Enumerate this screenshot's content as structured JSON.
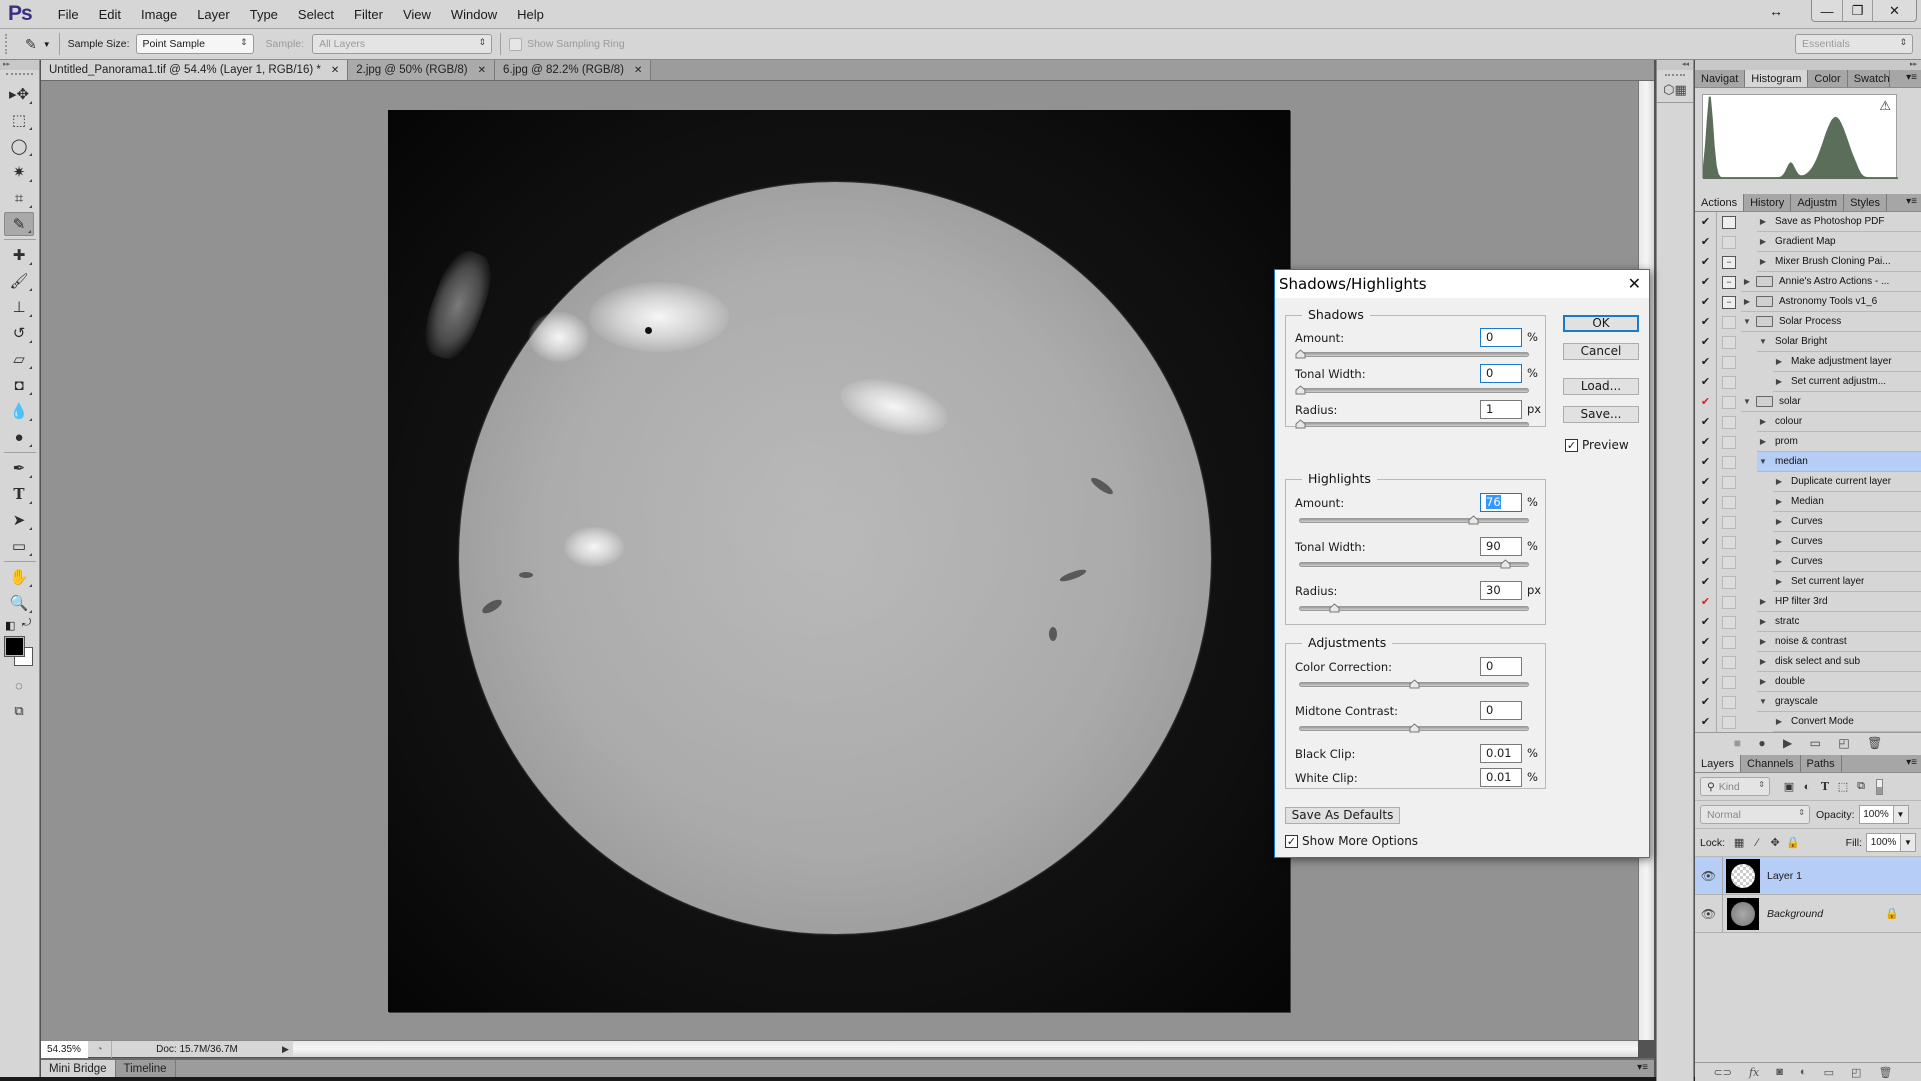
{
  "app": {
    "logo": "Ps",
    "menu": [
      "File",
      "Edit",
      "Image",
      "Layer",
      "Type",
      "Select",
      "Filter",
      "View",
      "Window",
      "Help"
    ],
    "window_controls": {
      "minimize": "—",
      "restore": "❐",
      "close": "✕",
      "resize": "↔"
    }
  },
  "options_bar": {
    "tool_icon": "eyedropper-icon",
    "sample_size_label": "Sample Size:",
    "sample_size_value": "Point Sample",
    "sample_label": "Sample:",
    "sample_value": "All Layers",
    "show_sampling_ring_label": "Show Sampling Ring",
    "show_sampling_ring_checked": false,
    "workspace": "Essentials"
  },
  "document_tabs": [
    {
      "label": "Untitled_Panorama1.tif @ 54.4% (Layer 1, RGB/16) *",
      "active": true
    },
    {
      "label": "2.jpg @ 50% (RGB/8)",
      "active": false
    },
    {
      "label": "6.jpg @ 82.2% (RGB/8)",
      "active": false
    }
  ],
  "tools": [
    {
      "name": "move-tool",
      "glyph": "▸✥"
    },
    {
      "name": "rectangular-marquee-tool",
      "glyph": "⬚"
    },
    {
      "name": "lasso-tool",
      "glyph": "◯"
    },
    {
      "name": "quick-selection-tool",
      "glyph": "✷"
    },
    {
      "name": "crop-tool",
      "glyph": "⌗"
    },
    {
      "name": "eyedropper-tool",
      "glyph": "✎",
      "active": true
    },
    {
      "sep": true
    },
    {
      "name": "spot-healing-brush-tool",
      "glyph": "✚"
    },
    {
      "name": "brush-tool",
      "glyph": "🖌"
    },
    {
      "name": "clone-stamp-tool",
      "glyph": "⊥"
    },
    {
      "name": "history-brush-tool",
      "glyph": "↺"
    },
    {
      "name": "eraser-tool",
      "glyph": "▱"
    },
    {
      "name": "paint-bucket-tool",
      "glyph": "◘"
    },
    {
      "name": "blur-tool",
      "glyph": "💧"
    },
    {
      "name": "dodge-tool",
      "glyph": "●"
    },
    {
      "sep": true
    },
    {
      "name": "pen-tool",
      "glyph": "✒"
    },
    {
      "name": "type-tool",
      "glyph": "T"
    },
    {
      "name": "path-selection-tool",
      "glyph": "➤"
    },
    {
      "name": "rectangle-tool",
      "glyph": "▭"
    },
    {
      "sep": true
    },
    {
      "name": "hand-tool",
      "glyph": "✋"
    },
    {
      "name": "zoom-tool",
      "glyph": "🔍"
    }
  ],
  "colors": {
    "foreground": "#000000",
    "background": "#ffffff",
    "accent": "#1979ca",
    "selection": "#b6cdf5",
    "histogram_fill": "#5b6e5a"
  },
  "status_bar": {
    "zoom": "54.35%",
    "doc_info": "Doc: 15.7M/36.7M"
  },
  "bottom_tabs": [
    {
      "label": "Mini Bridge",
      "active": true
    },
    {
      "label": "Timeline",
      "active": false
    }
  ],
  "histogram_panel": {
    "tabs": [
      {
        "label": "Navigat",
        "active": false
      },
      {
        "label": "Histogram",
        "active": true
      },
      {
        "label": "Color",
        "active": false
      },
      {
        "label": "Swatch",
        "active": false
      }
    ],
    "warning_icon": "⚠"
  },
  "actions_panel": {
    "tabs": [
      {
        "label": "Actions",
        "active": true
      },
      {
        "label": "History",
        "active": false
      },
      {
        "label": "Adjustm",
        "active": false
      },
      {
        "label": "Styles",
        "active": false
      }
    ],
    "rows": [
      {
        "label": "Save as Photoshop PDF",
        "level": 1,
        "expanded": false,
        "folder": false,
        "dialog": "on",
        "check": "black"
      },
      {
        "label": "Gradient Map",
        "level": 1,
        "expanded": false,
        "folder": false,
        "dialog": "off",
        "check": "black"
      },
      {
        "label": "Mixer Brush Cloning Pai...",
        "level": 1,
        "expanded": false,
        "folder": false,
        "dialog": "partial",
        "check": "black"
      },
      {
        "label": "Annie's Astro Actions - ...",
        "level": 0,
        "expanded": false,
        "folder": true,
        "dialog": "partial",
        "check": "black"
      },
      {
        "label": "Astronomy Tools v1_6",
        "level": 0,
        "expanded": false,
        "folder": true,
        "dialog": "partial",
        "check": "black"
      },
      {
        "label": "Solar Process",
        "level": 0,
        "expanded": true,
        "folder": true,
        "dialog": "off",
        "check": "black"
      },
      {
        "label": "Solar Bright",
        "level": 1,
        "expanded": true,
        "folder": false,
        "dialog": "off",
        "check": "black"
      },
      {
        "label": "Make adjustment layer",
        "level": 2,
        "expanded": false,
        "folder": false,
        "dialog": "off",
        "check": "black"
      },
      {
        "label": "Set current adjustm...",
        "level": 2,
        "expanded": false,
        "folder": false,
        "dialog": "off",
        "check": "black"
      },
      {
        "label": "solar",
        "level": 0,
        "expanded": true,
        "folder": true,
        "dialog": "off",
        "check": "red"
      },
      {
        "label": "colour",
        "level": 1,
        "expanded": false,
        "folder": false,
        "dialog": "off",
        "check": "black"
      },
      {
        "label": "prom",
        "level": 1,
        "expanded": false,
        "folder": false,
        "dialog": "off",
        "check": "black"
      },
      {
        "label": "median",
        "level": 1,
        "expanded": true,
        "folder": false,
        "dialog": "off",
        "check": "black",
        "selected": true
      },
      {
        "label": "Duplicate current layer",
        "level": 2,
        "expanded": false,
        "folder": false,
        "dialog": "off",
        "check": "black"
      },
      {
        "label": "Median",
        "level": 2,
        "expanded": false,
        "folder": false,
        "dialog": "off",
        "check": "black"
      },
      {
        "label": "Curves",
        "level": 2,
        "expanded": false,
        "folder": false,
        "dialog": "off",
        "check": "black"
      },
      {
        "label": "Curves",
        "level": 2,
        "expanded": false,
        "folder": false,
        "dialog": "off",
        "check": "black"
      },
      {
        "label": "Curves",
        "level": 2,
        "expanded": false,
        "folder": false,
        "dialog": "off",
        "check": "black"
      },
      {
        "label": "Set current layer",
        "level": 2,
        "expanded": false,
        "folder": false,
        "dialog": "off",
        "check": "black"
      },
      {
        "label": "HP filter 3rd",
        "level": 1,
        "expanded": false,
        "folder": false,
        "dialog": "off",
        "check": "red"
      },
      {
        "label": "stratc",
        "level": 1,
        "expanded": false,
        "folder": false,
        "dialog": "off",
        "check": "black"
      },
      {
        "label": "noise & contrast",
        "level": 1,
        "expanded": false,
        "folder": false,
        "dialog": "off",
        "check": "black"
      },
      {
        "label": "disk select and sub",
        "level": 1,
        "expanded": false,
        "folder": false,
        "dialog": "off",
        "check": "black"
      },
      {
        "label": "double",
        "level": 1,
        "expanded": false,
        "folder": false,
        "dialog": "off",
        "check": "black"
      },
      {
        "label": "grayscale",
        "level": 1,
        "expanded": true,
        "folder": false,
        "dialog": "off",
        "check": "black"
      },
      {
        "label": "Convert Mode",
        "level": 2,
        "expanded": false,
        "folder": false,
        "dialog": "off",
        "check": "black"
      }
    ],
    "buttons": [
      "stop-icon",
      "record-icon",
      "play-icon",
      "new-set-icon",
      "new-action-icon",
      "trash-icon"
    ]
  },
  "layers_panel": {
    "tabs": [
      {
        "label": "Layers",
        "active": true
      },
      {
        "label": "Channels",
        "active": false
      },
      {
        "label": "Paths",
        "active": false
      }
    ],
    "filter_kind": "Kind",
    "blend_mode": "Normal",
    "opacity_label": "Opacity:",
    "opacity": "100%",
    "lock_label": "Lock:",
    "fill_label": "Fill:",
    "fill": "100%",
    "layers": [
      {
        "name": "Layer 1",
        "visible": true,
        "selected": true,
        "locked": false
      },
      {
        "name": "Background",
        "visible": true,
        "selected": false,
        "locked": true
      }
    ]
  },
  "dialog": {
    "title": "Shadows/Highlights",
    "shadows": {
      "legend": "Shadows",
      "amount_label": "Amount:",
      "amount": "0",
      "amount_unit": "%",
      "tonal_width_label": "Tonal Width:",
      "tonal_width": "0",
      "tonal_width_unit": "%",
      "radius_label": "Radius:",
      "radius": "1",
      "radius_unit": "px",
      "amount_slider": 0,
      "tonal_width_slider": 0,
      "radius_slider": 0
    },
    "highlights": {
      "legend": "Highlights",
      "amount_label": "Amount:",
      "amount": "76",
      "amount_unit": "%",
      "tonal_width_label": "Tonal Width:",
      "tonal_width": "90",
      "tonal_width_unit": "%",
      "radius_label": "Radius:",
      "radius": "30",
      "radius_unit": "px",
      "amount_slider": 0.76,
      "tonal_width_slider": 0.9,
      "radius_slider": 0.15
    },
    "adjustments": {
      "legend": "Adjustments",
      "color_correction_label": "Color Correction:",
      "color_correction": "0",
      "midtone_contrast_label": "Midtone Contrast:",
      "midtone_contrast": "0",
      "color_correction_slider": 0.5,
      "midtone_contrast_slider": 0.5,
      "black_clip_label": "Black Clip:",
      "black_clip": "0.01",
      "black_clip_unit": "%",
      "white_clip_label": "White Clip:",
      "white_clip": "0.01",
      "white_clip_unit": "%"
    },
    "buttons": {
      "ok": "OK",
      "cancel": "Cancel",
      "load": "Load...",
      "save": "Save...",
      "save_defaults": "Save As Defaults"
    },
    "preview_label": "Preview",
    "preview_checked": true,
    "show_more_label": "Show More Options",
    "show_more_checked": true
  }
}
